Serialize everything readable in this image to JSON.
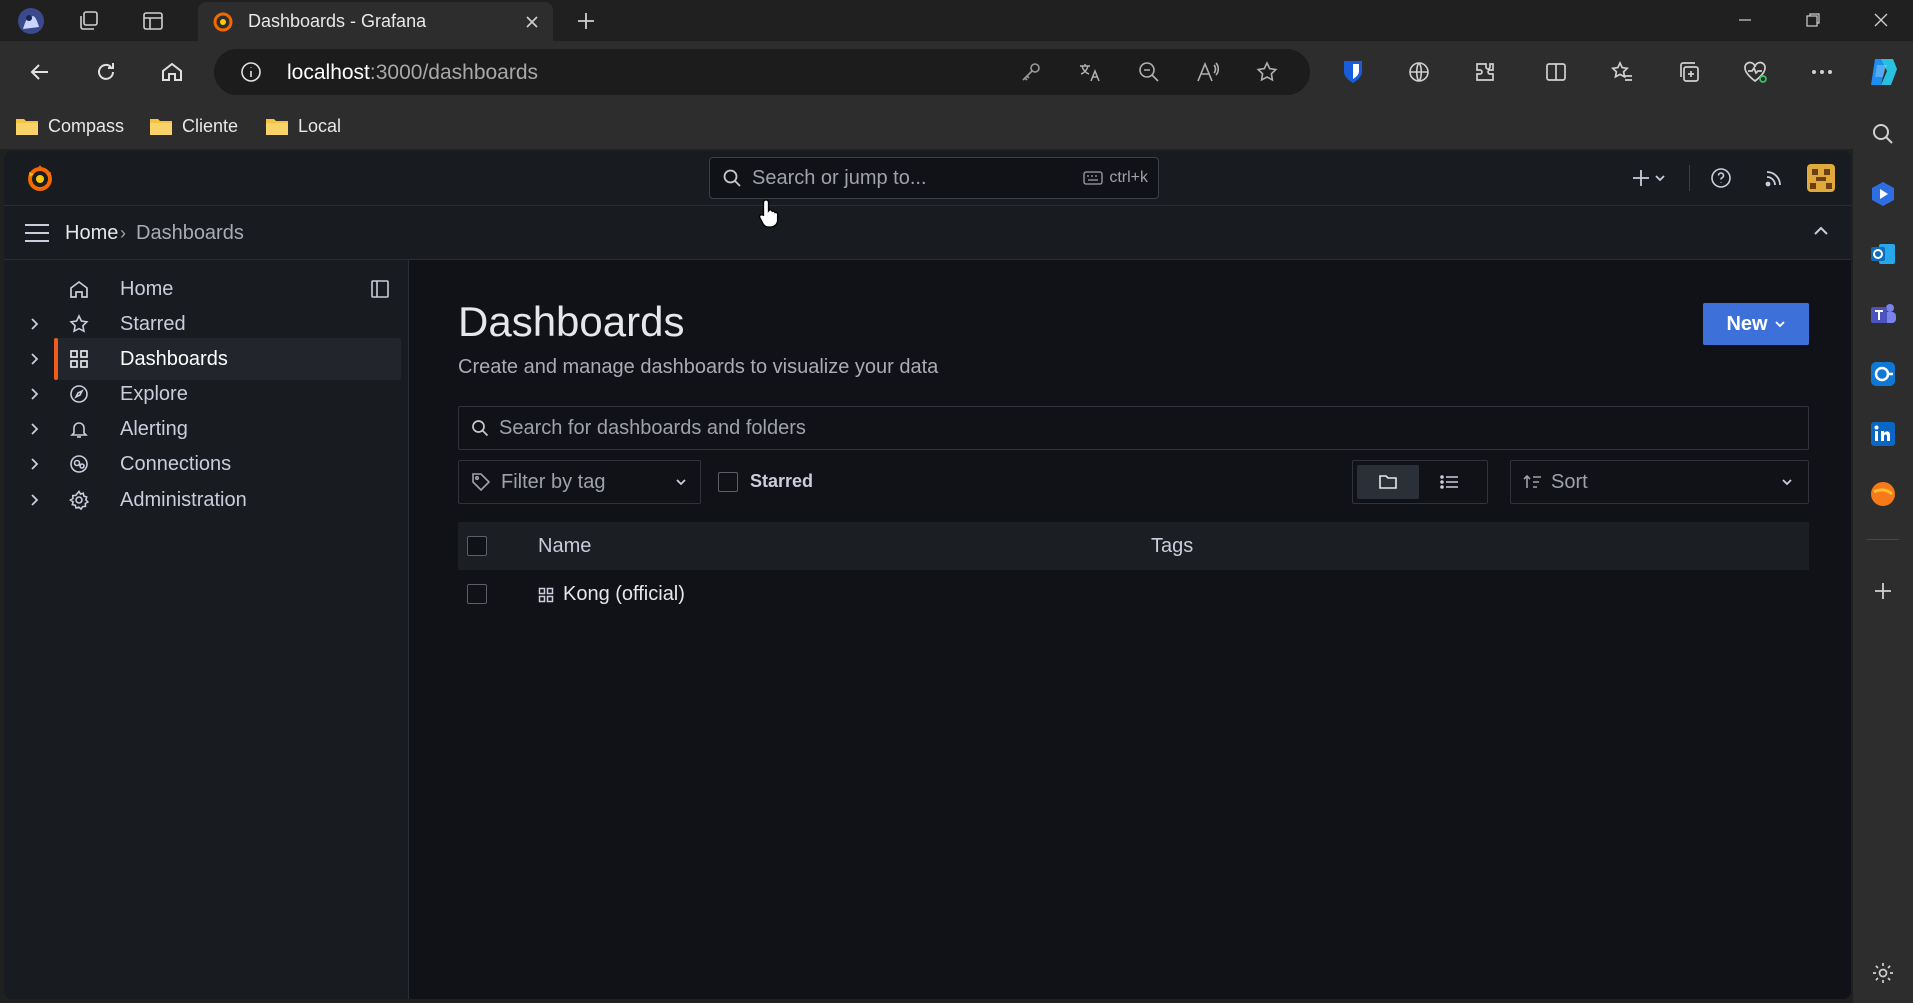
{
  "browser": {
    "tab_title": "Dashboards - Grafana",
    "url_host": "localhost",
    "url_rest": ":3000/dashboards",
    "bookmarks": [
      {
        "label": "Compass"
      },
      {
        "label": "Cliente"
      },
      {
        "label": "Local"
      }
    ]
  },
  "grafana": {
    "search_placeholder": "Search or jump to...",
    "search_shortcut": "ctrl+k",
    "breadcrumb": {
      "home": "Home",
      "separator": "›",
      "current": "Dashboards"
    },
    "nav": [
      {
        "label": "Home"
      },
      {
        "label": "Starred"
      },
      {
        "label": "Dashboards"
      },
      {
        "label": "Explore"
      },
      {
        "label": "Alerting"
      },
      {
        "label": "Connections"
      },
      {
        "label": "Administration"
      }
    ],
    "page": {
      "title": "Dashboards",
      "subtitle": "Create and manage dashboards to visualize your data",
      "new_button": "New",
      "search_placeholder": "Search for dashboards and folders",
      "tag_filter_placeholder": "Filter by tag",
      "starred_label": "Starred",
      "sort_placeholder": "Sort",
      "columns": {
        "name": "Name",
        "tags": "Tags"
      },
      "rows": [
        {
          "name": "Kong (official)",
          "tags": ""
        }
      ]
    }
  },
  "colors": {
    "accent_orange": "#f15b1c",
    "primary_blue": "#3d71d9",
    "background": "#111217"
  }
}
